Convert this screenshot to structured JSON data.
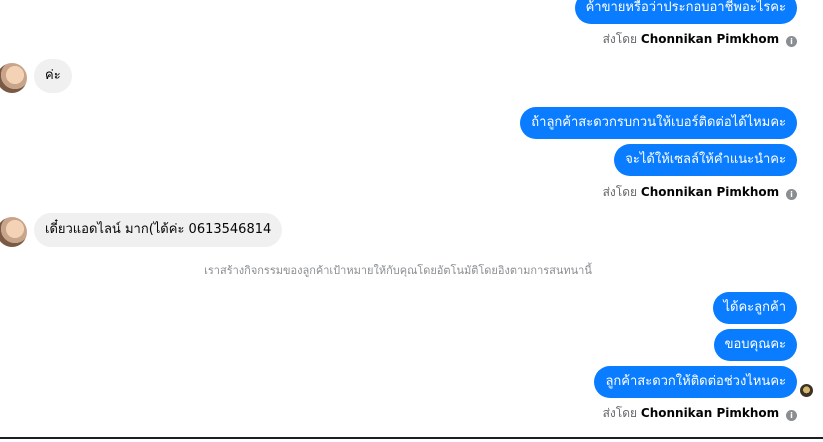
{
  "colors": {
    "outgoing_bubble": "#0a7cff",
    "incoming_bubble": "#f0f0f0",
    "meta_text": "#65676b"
  },
  "messages": [
    {
      "type": "outgoing",
      "text": "ค้าขายหรือว่าประกอบอาชีพอะไรคะ"
    },
    {
      "type": "incoming",
      "text": "ค่ะ"
    },
    {
      "type": "outgoing",
      "text": "ถ้าลูกค้าสะดวกรบกวนให้เบอร์ติดต่อได้ไหมคะ"
    },
    {
      "type": "outgoing",
      "text": "จะได้ให้เซลล์ให้คำแนะนำคะ"
    },
    {
      "type": "incoming",
      "text": "เดี๋ยวแอดไลน์ มาก(ได้ค่ะ 0613546814"
    },
    {
      "type": "outgoing",
      "text": "ได้คะลูกค้า"
    },
    {
      "type": "outgoing",
      "text": "ขอบคุณคะ"
    },
    {
      "type": "outgoing",
      "text": "ลูกค้าสะดวกให้ติดต่อช่วงไหนคะ"
    }
  ],
  "sent_by": {
    "prefix": "ส่งโดย",
    "name": "Chonnikan Pimkhom",
    "info_icon": "info-icon"
  },
  "system_note": "เราสร้างกิจกรรมของลูกค้าเป้าหมายให้กับคุณโดยอัตโนมัติโดยอิงตามการสนทนานี้"
}
